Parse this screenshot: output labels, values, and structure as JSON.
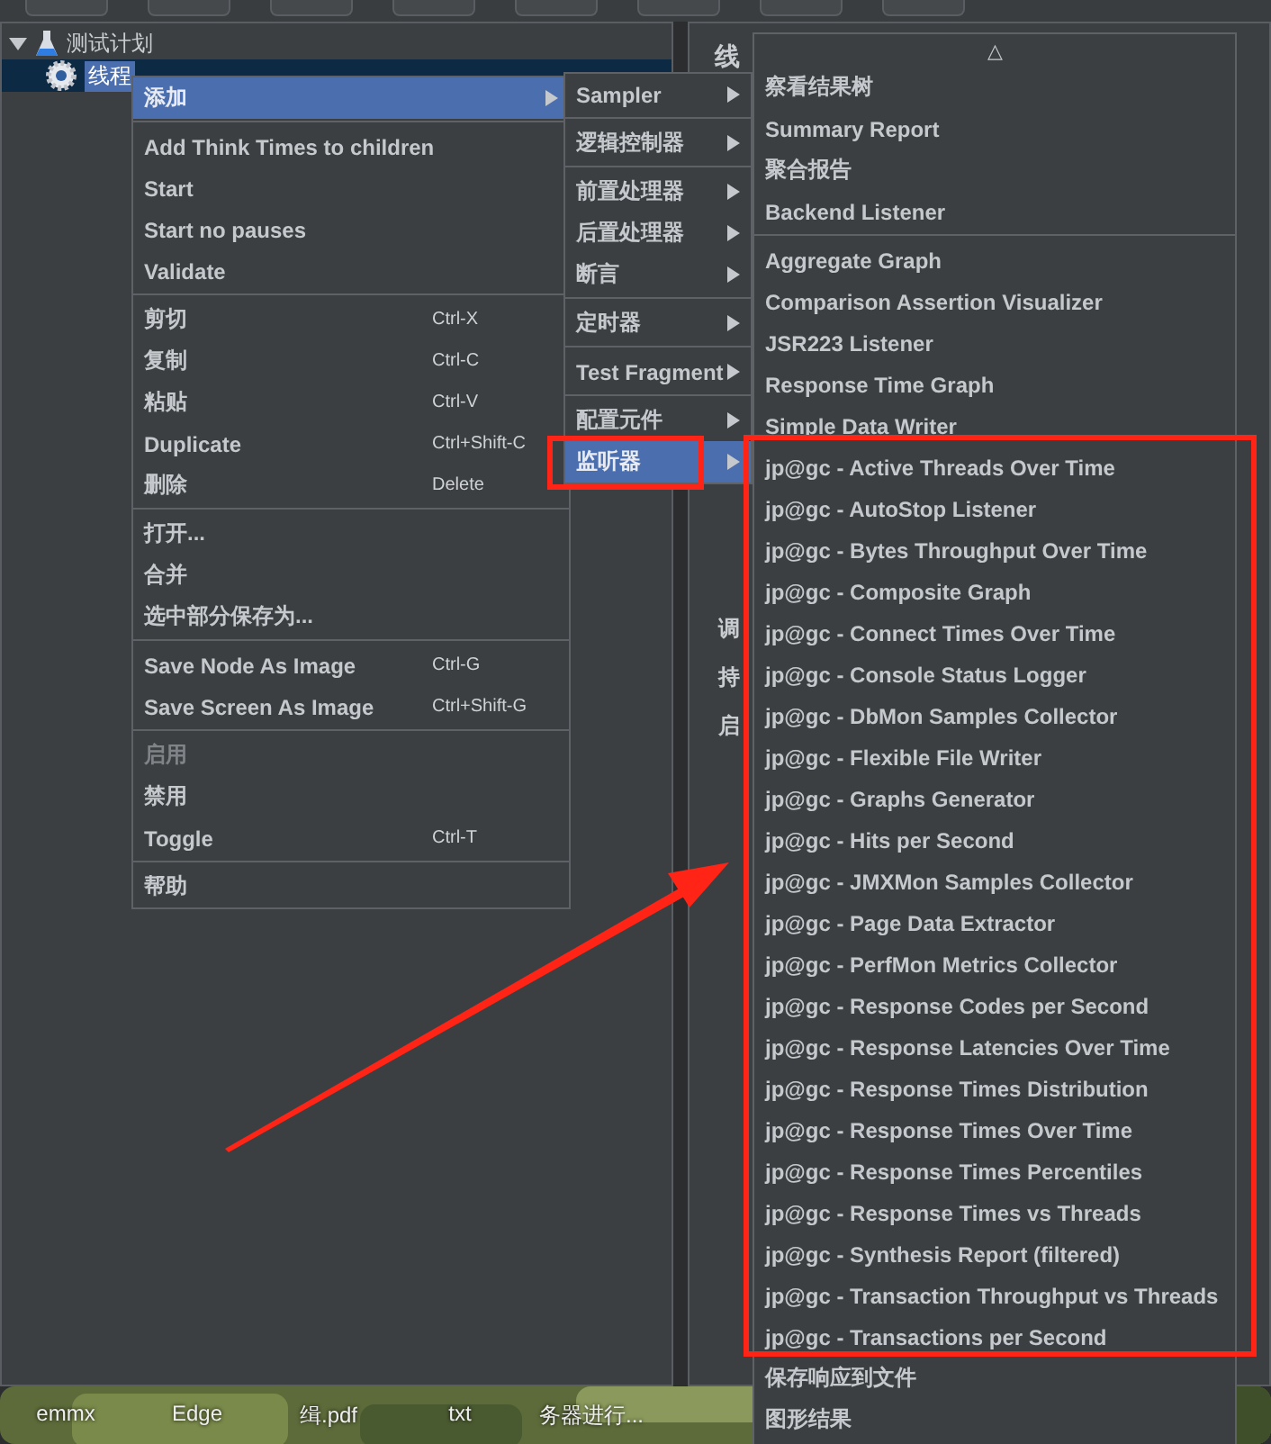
{
  "tree": [
    {
      "label": "测试计划",
      "expanded": true,
      "selected": false,
      "children": [
        {
          "label": "线程",
          "selected": true
        }
      ]
    }
  ],
  "right_panel": {
    "title": "线",
    "fragments": [
      "调",
      "持",
      "启"
    ]
  },
  "context_menu": {
    "groups": [
      [
        {
          "label": "添加",
          "submenu": true,
          "selected": true,
          "disabled": false
        }
      ],
      [
        {
          "label": "Add Think Times to children",
          "submenu": false,
          "selected": false,
          "disabled": false
        },
        {
          "label": "Start",
          "submenu": false,
          "selected": false,
          "disabled": false
        },
        {
          "label": "Start no pauses",
          "submenu": false,
          "selected": false,
          "disabled": false
        },
        {
          "label": "Validate",
          "submenu": false,
          "selected": false,
          "disabled": false
        }
      ],
      [
        {
          "label": "剪切",
          "shortcut": "Ctrl-X",
          "submenu": false,
          "selected": false,
          "disabled": false
        },
        {
          "label": "复制",
          "shortcut": "Ctrl-C",
          "submenu": false,
          "selected": false,
          "disabled": false
        },
        {
          "label": "粘贴",
          "shortcut": "Ctrl-V",
          "submenu": false,
          "selected": false,
          "disabled": false
        },
        {
          "label": "Duplicate",
          "shortcut": "Ctrl+Shift-C",
          "submenu": false,
          "selected": false,
          "disabled": false
        },
        {
          "label": "删除",
          "shortcut": "Delete",
          "submenu": false,
          "selected": false,
          "disabled": false
        }
      ],
      [
        {
          "label": "打开...",
          "submenu": false,
          "selected": false,
          "disabled": false
        },
        {
          "label": "合并",
          "submenu": false,
          "selected": false,
          "disabled": false
        },
        {
          "label": "选中部分保存为...",
          "submenu": false,
          "selected": false,
          "disabled": false
        }
      ],
      [
        {
          "label": "Save Node As Image",
          "shortcut": "Ctrl-G",
          "submenu": false,
          "selected": false,
          "disabled": false
        },
        {
          "label": "Save Screen As Image",
          "shortcut": "Ctrl+Shift-G",
          "submenu": false,
          "selected": false,
          "disabled": false
        }
      ],
      [
        {
          "label": "启用",
          "submenu": false,
          "selected": false,
          "disabled": true
        },
        {
          "label": "禁用",
          "submenu": false,
          "selected": false,
          "disabled": false
        },
        {
          "label": "Toggle",
          "shortcut": "Ctrl-T",
          "submenu": false,
          "selected": false,
          "disabled": false
        }
      ],
      [
        {
          "label": "帮助",
          "submenu": false,
          "selected": false,
          "disabled": false
        }
      ]
    ]
  },
  "add_submenu": {
    "groups": [
      [
        {
          "label": "Sampler",
          "submenu": true,
          "selected": false,
          "disabled": false
        }
      ],
      [
        {
          "label": "逻辑控制器",
          "submenu": true,
          "selected": false,
          "disabled": false
        }
      ],
      [
        {
          "label": "前置处理器",
          "submenu": true,
          "selected": false,
          "disabled": false
        },
        {
          "label": "后置处理器",
          "submenu": true,
          "selected": false,
          "disabled": false
        },
        {
          "label": "断言",
          "submenu": true,
          "selected": false,
          "disabled": false
        }
      ],
      [
        {
          "label": "定时器",
          "submenu": true,
          "selected": false,
          "disabled": false
        }
      ],
      [
        {
          "label": "Test Fragment",
          "submenu": true,
          "selected": false,
          "disabled": false
        }
      ],
      [
        {
          "label": "配置元件",
          "submenu": true,
          "selected": false,
          "disabled": false
        },
        {
          "label": "监听器",
          "submenu": true,
          "selected": true,
          "disabled": false
        }
      ]
    ]
  },
  "listener_menu": {
    "scroll_up": "△",
    "groups": [
      [
        {
          "label": "察看结果树",
          "submenu": false,
          "selected": false,
          "disabled": false
        },
        {
          "label": "Summary Report",
          "submenu": false,
          "selected": false,
          "disabled": false
        },
        {
          "label": "聚合报告",
          "submenu": false,
          "selected": false,
          "disabled": false
        },
        {
          "label": "Backend Listener",
          "submenu": false,
          "selected": false,
          "disabled": false
        }
      ],
      [
        {
          "label": "Aggregate Graph",
          "submenu": false,
          "selected": false,
          "disabled": false
        },
        {
          "label": "Comparison Assertion Visualizer",
          "submenu": false,
          "selected": false,
          "disabled": false
        },
        {
          "label": "JSR223 Listener",
          "submenu": false,
          "selected": false,
          "disabled": false
        },
        {
          "label": "Response Time Graph",
          "submenu": false,
          "selected": false,
          "disabled": false
        },
        {
          "label": "Simple Data Writer",
          "submenu": false,
          "selected": false,
          "disabled": false
        },
        {
          "label": "jp@gc - Active Threads Over Time",
          "submenu": false,
          "selected": false,
          "disabled": false
        },
        {
          "label": "jp@gc - AutoStop Listener",
          "submenu": false,
          "selected": false,
          "disabled": false
        },
        {
          "label": "jp@gc - Bytes Throughput Over Time",
          "submenu": false,
          "selected": false,
          "disabled": false
        },
        {
          "label": "jp@gc - Composite Graph",
          "submenu": false,
          "selected": false,
          "disabled": false
        },
        {
          "label": "jp@gc - Connect Times Over Time",
          "submenu": false,
          "selected": false,
          "disabled": false
        },
        {
          "label": "jp@gc - Console Status Logger",
          "submenu": false,
          "selected": false,
          "disabled": false
        },
        {
          "label": "jp@gc - DbMon Samples Collector",
          "submenu": false,
          "selected": false,
          "disabled": false
        },
        {
          "label": "jp@gc - Flexible File Writer",
          "submenu": false,
          "selected": false,
          "disabled": false
        },
        {
          "label": "jp@gc - Graphs Generator",
          "submenu": false,
          "selected": false,
          "disabled": false
        },
        {
          "label": "jp@gc - Hits per Second",
          "submenu": false,
          "selected": false,
          "disabled": false
        },
        {
          "label": "jp@gc - JMXMon Samples Collector",
          "submenu": false,
          "selected": false,
          "disabled": false
        },
        {
          "label": "jp@gc - Page Data Extractor",
          "submenu": false,
          "selected": false,
          "disabled": false
        },
        {
          "label": "jp@gc - PerfMon Metrics Collector",
          "submenu": false,
          "selected": false,
          "disabled": false
        },
        {
          "label": "jp@gc - Response Codes per Second",
          "submenu": false,
          "selected": false,
          "disabled": false
        },
        {
          "label": "jp@gc - Response Latencies Over Time",
          "submenu": false,
          "selected": false,
          "disabled": false
        },
        {
          "label": "jp@gc - Response Times Distribution",
          "submenu": false,
          "selected": false,
          "disabled": false
        },
        {
          "label": "jp@gc - Response Times Over Time",
          "submenu": false,
          "selected": false,
          "disabled": false
        },
        {
          "label": "jp@gc - Response Times Percentiles",
          "submenu": false,
          "selected": false,
          "disabled": false
        },
        {
          "label": "jp@gc - Response Times vs Threads",
          "submenu": false,
          "selected": false,
          "disabled": false
        },
        {
          "label": "jp@gc - Synthesis Report (filtered)",
          "submenu": false,
          "selected": false,
          "disabled": false
        },
        {
          "label": "jp@gc - Transaction Throughput vs Threads",
          "submenu": false,
          "selected": false,
          "disabled": false
        },
        {
          "label": "jp@gc - Transactions per Second",
          "submenu": false,
          "selected": false,
          "disabled": false
        },
        {
          "label": "保存响应到文件",
          "submenu": false,
          "selected": false,
          "disabled": false
        },
        {
          "label": "图形结果",
          "submenu": false,
          "selected": false,
          "disabled": false
        }
      ]
    ]
  },
  "desktop_labels": [
    "emmx",
    "Edge",
    "缉.pdf",
    "txt",
    "务器进行..."
  ]
}
